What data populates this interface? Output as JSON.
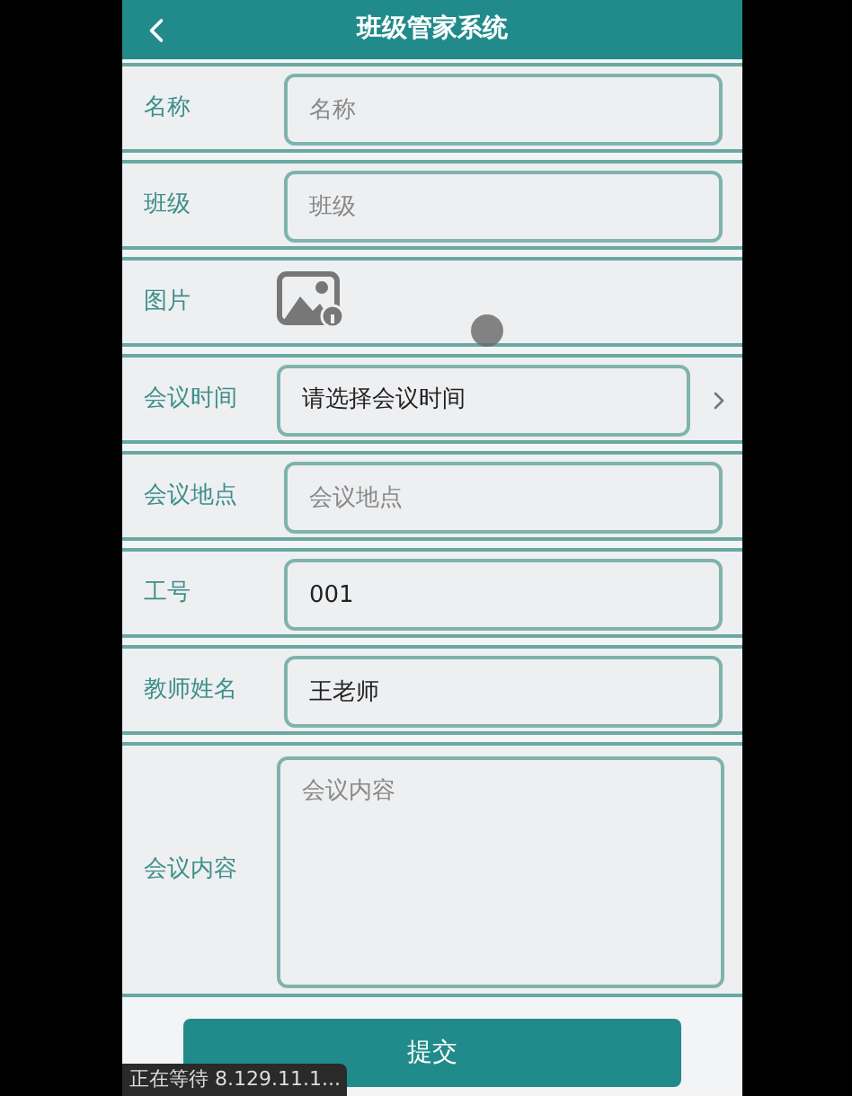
{
  "header": {
    "title": "班级管家系统"
  },
  "fields": [
    {
      "kind": "input",
      "label": "名称",
      "placeholder": "名称"
    },
    {
      "kind": "input",
      "label": "班级",
      "placeholder": "班级"
    },
    {
      "kind": "image",
      "label": "图片"
    },
    {
      "kind": "picker",
      "label": "会议时间",
      "value": "请选择会议时间"
    },
    {
      "kind": "input",
      "label": "会议地点",
      "placeholder": "会议地点"
    },
    {
      "kind": "input",
      "label": "工号",
      "value": "001"
    },
    {
      "kind": "input",
      "label": "教师姓名",
      "value": "王老师"
    },
    {
      "kind": "textarea",
      "label": "会议内容",
      "placeholder": "会议内容"
    }
  ],
  "submit_button": "提交",
  "status_tooltip": "正在等待 8.129.11.1..."
}
